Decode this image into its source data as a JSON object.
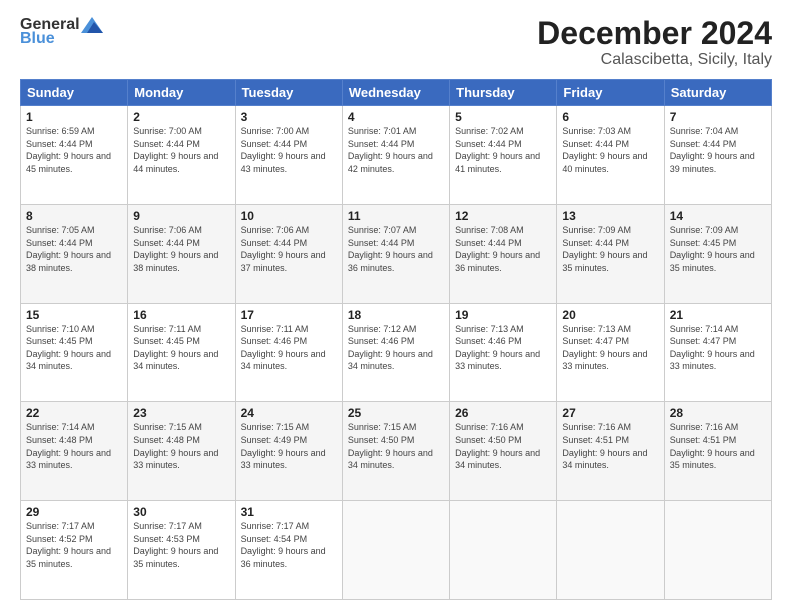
{
  "logo": {
    "general": "General",
    "blue": "Blue"
  },
  "title": "December 2024",
  "subtitle": "Calascibetta, Sicily, Italy",
  "days_header": [
    "Sunday",
    "Monday",
    "Tuesday",
    "Wednesday",
    "Thursday",
    "Friday",
    "Saturday"
  ],
  "weeks": [
    [
      {
        "day": "1",
        "sunrise": "6:59 AM",
        "sunset": "4:44 PM",
        "daylight": "9 hours and 45 minutes."
      },
      {
        "day": "2",
        "sunrise": "7:00 AM",
        "sunset": "4:44 PM",
        "daylight": "9 hours and 44 minutes."
      },
      {
        "day": "3",
        "sunrise": "7:00 AM",
        "sunset": "4:44 PM",
        "daylight": "9 hours and 43 minutes."
      },
      {
        "day": "4",
        "sunrise": "7:01 AM",
        "sunset": "4:44 PM",
        "daylight": "9 hours and 42 minutes."
      },
      {
        "day": "5",
        "sunrise": "7:02 AM",
        "sunset": "4:44 PM",
        "daylight": "9 hours and 41 minutes."
      },
      {
        "day": "6",
        "sunrise": "7:03 AM",
        "sunset": "4:44 PM",
        "daylight": "9 hours and 40 minutes."
      },
      {
        "day": "7",
        "sunrise": "7:04 AM",
        "sunset": "4:44 PM",
        "daylight": "9 hours and 39 minutes."
      }
    ],
    [
      {
        "day": "8",
        "sunrise": "7:05 AM",
        "sunset": "4:44 PM",
        "daylight": "9 hours and 38 minutes."
      },
      {
        "day": "9",
        "sunrise": "7:06 AM",
        "sunset": "4:44 PM",
        "daylight": "9 hours and 38 minutes."
      },
      {
        "day": "10",
        "sunrise": "7:06 AM",
        "sunset": "4:44 PM",
        "daylight": "9 hours and 37 minutes."
      },
      {
        "day": "11",
        "sunrise": "7:07 AM",
        "sunset": "4:44 PM",
        "daylight": "9 hours and 36 minutes."
      },
      {
        "day": "12",
        "sunrise": "7:08 AM",
        "sunset": "4:44 PM",
        "daylight": "9 hours and 36 minutes."
      },
      {
        "day": "13",
        "sunrise": "7:09 AM",
        "sunset": "4:44 PM",
        "daylight": "9 hours and 35 minutes."
      },
      {
        "day": "14",
        "sunrise": "7:09 AM",
        "sunset": "4:45 PM",
        "daylight": "9 hours and 35 minutes."
      }
    ],
    [
      {
        "day": "15",
        "sunrise": "7:10 AM",
        "sunset": "4:45 PM",
        "daylight": "9 hours and 34 minutes."
      },
      {
        "day": "16",
        "sunrise": "7:11 AM",
        "sunset": "4:45 PM",
        "daylight": "9 hours and 34 minutes."
      },
      {
        "day": "17",
        "sunrise": "7:11 AM",
        "sunset": "4:46 PM",
        "daylight": "9 hours and 34 minutes."
      },
      {
        "day": "18",
        "sunrise": "7:12 AM",
        "sunset": "4:46 PM",
        "daylight": "9 hours and 34 minutes."
      },
      {
        "day": "19",
        "sunrise": "7:13 AM",
        "sunset": "4:46 PM",
        "daylight": "9 hours and 33 minutes."
      },
      {
        "day": "20",
        "sunrise": "7:13 AM",
        "sunset": "4:47 PM",
        "daylight": "9 hours and 33 minutes."
      },
      {
        "day": "21",
        "sunrise": "7:14 AM",
        "sunset": "4:47 PM",
        "daylight": "9 hours and 33 minutes."
      }
    ],
    [
      {
        "day": "22",
        "sunrise": "7:14 AM",
        "sunset": "4:48 PM",
        "daylight": "9 hours and 33 minutes."
      },
      {
        "day": "23",
        "sunrise": "7:15 AM",
        "sunset": "4:48 PM",
        "daylight": "9 hours and 33 minutes."
      },
      {
        "day": "24",
        "sunrise": "7:15 AM",
        "sunset": "4:49 PM",
        "daylight": "9 hours and 33 minutes."
      },
      {
        "day": "25",
        "sunrise": "7:15 AM",
        "sunset": "4:50 PM",
        "daylight": "9 hours and 34 minutes."
      },
      {
        "day": "26",
        "sunrise": "7:16 AM",
        "sunset": "4:50 PM",
        "daylight": "9 hours and 34 minutes."
      },
      {
        "day": "27",
        "sunrise": "7:16 AM",
        "sunset": "4:51 PM",
        "daylight": "9 hours and 34 minutes."
      },
      {
        "day": "28",
        "sunrise": "7:16 AM",
        "sunset": "4:51 PM",
        "daylight": "9 hours and 35 minutes."
      }
    ],
    [
      {
        "day": "29",
        "sunrise": "7:17 AM",
        "sunset": "4:52 PM",
        "daylight": "9 hours and 35 minutes."
      },
      {
        "day": "30",
        "sunrise": "7:17 AM",
        "sunset": "4:53 PM",
        "daylight": "9 hours and 35 minutes."
      },
      {
        "day": "31",
        "sunrise": "7:17 AM",
        "sunset": "4:54 PM",
        "daylight": "9 hours and 36 minutes."
      },
      null,
      null,
      null,
      null
    ]
  ]
}
